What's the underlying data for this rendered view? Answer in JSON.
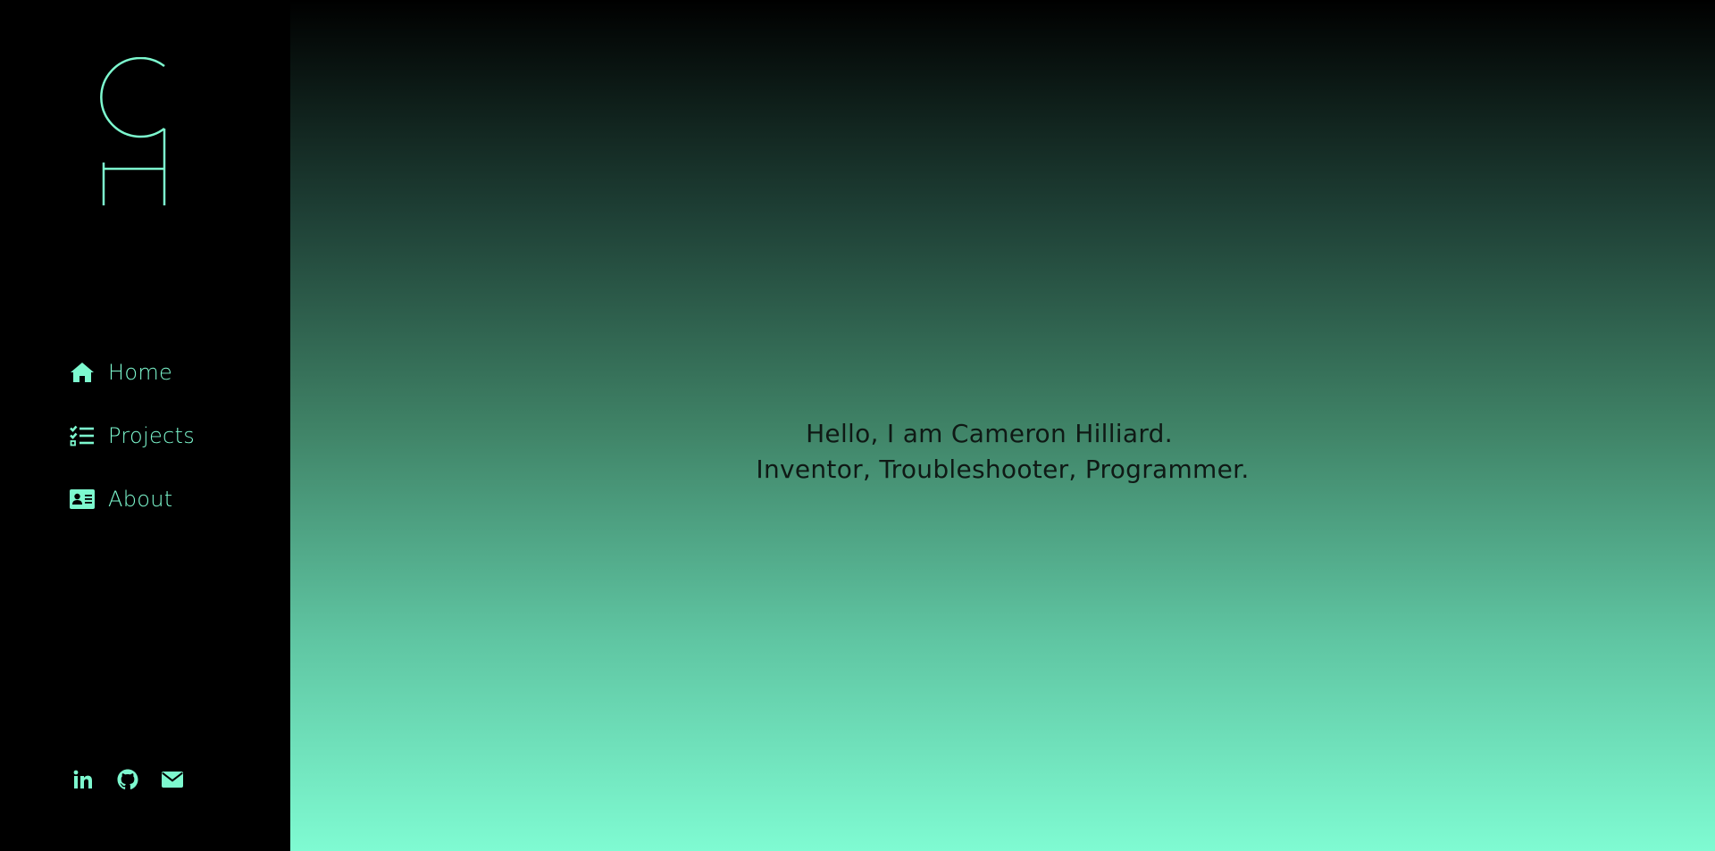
{
  "brand": {
    "logo_alt": "CH",
    "accent_color": "#7df9cf"
  },
  "nav": {
    "items": [
      {
        "label": "Home",
        "icon": "home-icon"
      },
      {
        "label": "Projects",
        "icon": "tasks-list-icon"
      },
      {
        "label": "About",
        "icon": "id-card-icon"
      }
    ]
  },
  "social": {
    "links": [
      {
        "icon": "linkedin-icon",
        "label": "LinkedIn"
      },
      {
        "icon": "github-icon",
        "label": "GitHub"
      },
      {
        "icon": "envelope-icon",
        "label": "Email"
      }
    ]
  },
  "hero": {
    "line1": "Hello, I am Cameron Hilliard.",
    "line2": "Inventor, Troubleshooter, Programmer."
  },
  "theme": {
    "gradient_top": "#000000",
    "gradient_bottom": "#7ffbd2",
    "hero_text_color": "#0f1915"
  }
}
